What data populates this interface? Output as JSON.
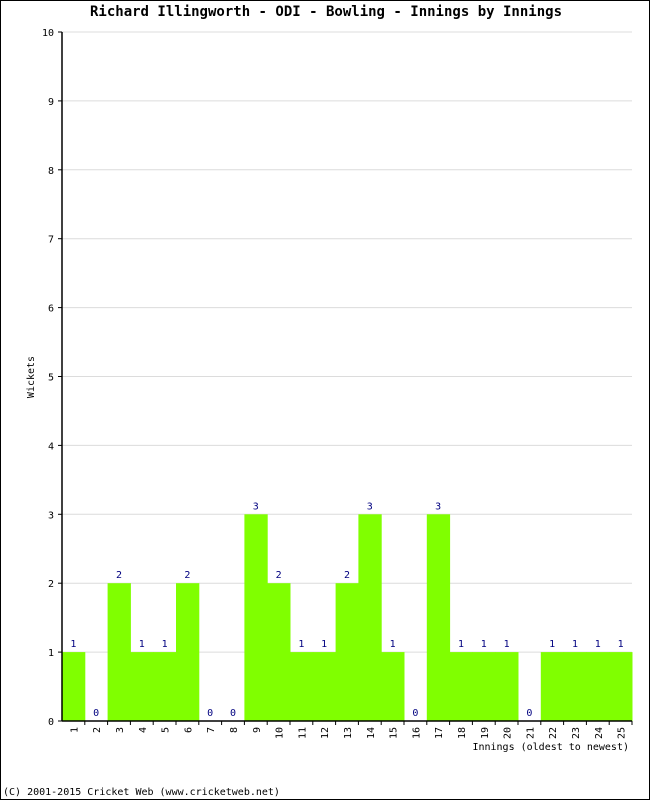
{
  "chart_data": {
    "type": "bar",
    "title": "Richard Illingworth - ODI - Bowling - Innings by Innings",
    "xlabel": "Innings (oldest to newest)",
    "ylabel": "Wickets",
    "ylim": [
      0,
      10
    ],
    "yticks": [
      0,
      1,
      2,
      3,
      4,
      5,
      6,
      7,
      8,
      9,
      10
    ],
    "grid": true,
    "bar_color": "#80ff00",
    "label_color": "#000080",
    "categories": [
      "1",
      "2",
      "3",
      "4",
      "5",
      "6",
      "7",
      "8",
      "9",
      "10",
      "11",
      "12",
      "13",
      "14",
      "15",
      "16",
      "17",
      "18",
      "19",
      "20",
      "21",
      "22",
      "23",
      "24",
      "25"
    ],
    "values": [
      1,
      0,
      2,
      1,
      1,
      2,
      0,
      0,
      3,
      2,
      1,
      1,
      2,
      3,
      1,
      0,
      3,
      1,
      1,
      1,
      0,
      1,
      1,
      1,
      1
    ]
  },
  "footer": "(C) 2001-2015 Cricket Web (www.cricketweb.net)"
}
